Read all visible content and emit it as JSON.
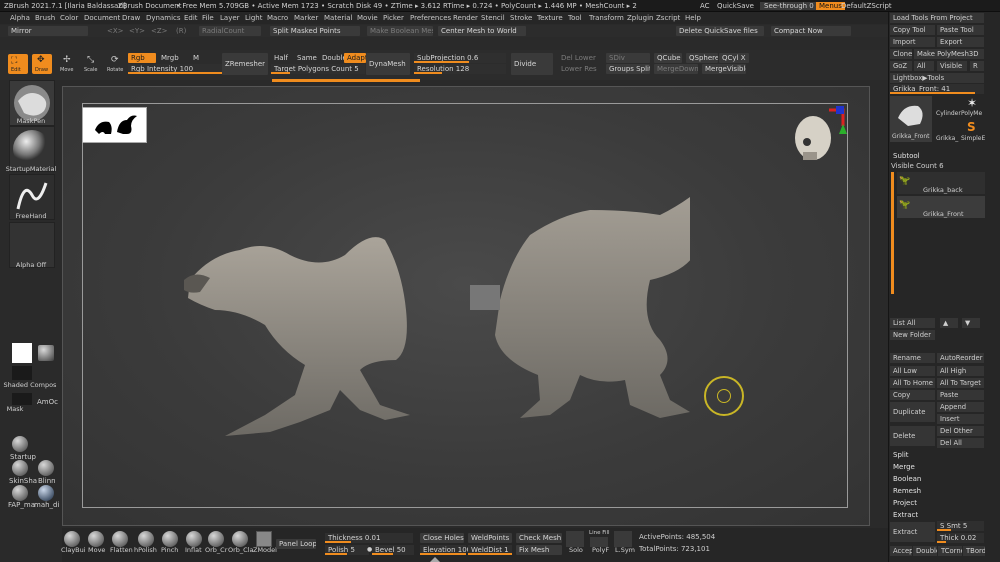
{
  "titlebar": {
    "app": "ZBrush 2021.7.1 [Ilaria Baldassari]",
    "doc": "ZBrush Document",
    "stats": "• Free Mem 5.709GB • Active Mem 1723 • Scratch Disk 49 • ZTime ▸ 3.612 RTime ▸ 0.724 • PolyCount ▸ 1.446 MP • MeshCount ▸ 2",
    "ac": "AC",
    "quicksave": "QuickSave",
    "seethrough": "See-through  0",
    "menus": "Menus",
    "script": "DefaultZScript"
  },
  "menubar": [
    "Alpha",
    "Brush",
    "Color",
    "Document",
    "Draw",
    "Dynamics",
    "Edit",
    "File",
    "Layer",
    "Light",
    "Macro",
    "Marker",
    "Material",
    "Movie",
    "Picker",
    "Preferences",
    "Render",
    "Stencil",
    "Stroke",
    "Texture",
    "Tool",
    "Transform",
    "Zplugin",
    "Zscript",
    "Help"
  ],
  "toolrow1": {
    "mirror": "Mirror",
    "xyz": [
      "<X>",
      "<Y>",
      "<Z>"
    ],
    "r": "(R)",
    "radialcount": "RadialCount",
    "split_masked": "Split Masked Points",
    "make_boolean": "Make Boolean Mesh",
    "center_mesh": "Center Mesh to World",
    "delete_quicksave": "Delete QuickSave files",
    "compact": "Compact Now"
  },
  "toolrow2": {
    "edit": "Edit",
    "draw": "Draw",
    "move": "Move",
    "scale": "Scale",
    "rotate": "Rotate",
    "rgb": "Rgb",
    "mrgb": "Mrgb",
    "m": "M",
    "rgb_intensity": "Rgb Intensity 100",
    "rgb_intensity_value": 100,
    "zremesher": "ZRemesher",
    "half": "Half",
    "same": "Same",
    "double": "Double",
    "adapt": "Adapt",
    "target_poly": "Target Polygons Count 5",
    "target_poly_fraction": 0.2,
    "dynamesh": "DynaMesh",
    "subprojection": "SubProjection 0.6",
    "subprojection_value": 0.6,
    "resolution": "Resolution 128",
    "resolution_fraction": 0.3,
    "divide": "Divide",
    "del_lower": "Del Lower",
    "sdiv": "SDiv",
    "lower_res": "Lower Res",
    "qcube": "QCube",
    "qsphere": "QSphere",
    "qcyl": "QCyl X",
    "groups_split": "Groups Split",
    "merge_down": "MergeDown",
    "merge_visible": "MergeVisible"
  },
  "leftshelf": {
    "brush": "MaskPen",
    "material": "StartupMaterial",
    "stroke": "FreeHand",
    "alpha": "Alpha Off",
    "shaded": "Shaded Compos",
    "amoc": "AmOc",
    "mask": "Mask",
    "startup": "Startup",
    "skinsha": "SkinSha",
    "blinn": "Blinn",
    "fap": "FAP_ma",
    "mah": "mah_di"
  },
  "rightpanel": {
    "load_tools": "Load Tools From Project",
    "copy_tool": "Copy Tool",
    "paste_tool": "Paste Tool",
    "import": "Import",
    "export": "Export",
    "clone": "Clone",
    "make_polymesh": "Make PolyMesh3D",
    "goz": "GoZ",
    "all": "All",
    "visible": "Visible",
    "r": "R",
    "lightbox": "Lightbox▶Tools",
    "current_tool": "Grikka_Front: 41",
    "current_tool_fraction": 0.9,
    "thumb1": "Grikka_Front",
    "thumb2": "Cylinder",
    "thumb3": "PolyMe",
    "thumb4": "Grikka_",
    "thumb5": "SimpleE",
    "subtool": "Subtool",
    "visible_count": "Visible Count 6",
    "sub1": "Grikka_back",
    "sub2": "Grikka_Front",
    "list_all": "List All",
    "new_folder": "New Folder",
    "rename": "Rename",
    "autoreorder": "AutoReorder",
    "all_low": "All Low",
    "all_high": "All High",
    "all_to_home": "All To Home",
    "all_to_target": "All To Target",
    "copy": "Copy",
    "paste": "Paste",
    "append": "Append",
    "duplicate": "Duplicate",
    "insert": "Insert",
    "delete": "Delete",
    "del_other": "Del Other",
    "del_all": "Del All",
    "split": "Split",
    "merge": "Merge",
    "boolean": "Boolean",
    "remesh": "Remesh",
    "project": "Project",
    "extract_head": "Extract",
    "s_smt": "S Smt 5",
    "extract": "Extract",
    "thick": "Thick 0.02",
    "accept": "Accept",
    "double": "Double",
    "tcorne": "TCorne",
    "tborder": "TBorde"
  },
  "bottombar": {
    "brushes": [
      "ClayBui",
      "Move",
      "Flatten",
      "hPolish",
      "Pinch",
      "Inflat",
      "Orb_Cr",
      "Orb_Cla",
      "ZModel"
    ],
    "panel_loops": "Panel Loops",
    "thickness": "Thickness 0.01",
    "polish": "Polish 5",
    "bevel": "Bevel 50",
    "close_holes": "Close Holes",
    "elevation": "Elevation 100",
    "weldpoints": "WeldPoints",
    "welddist": "WeldDist 1",
    "check_mesh": "Check Mesh Int",
    "fix_mesh": "Fix Mesh",
    "solo": "Solo",
    "polyf": "PolyF",
    "lsym": "L.Sym",
    "linefill": "Line Fill",
    "active_points": "ActivePoints: 485,504",
    "total_points": "TotalPoints: 723,101"
  },
  "colors": {
    "accent": "#f08c1e",
    "panel": "#2c2c2c",
    "viewport": "#3e3e3e"
  }
}
